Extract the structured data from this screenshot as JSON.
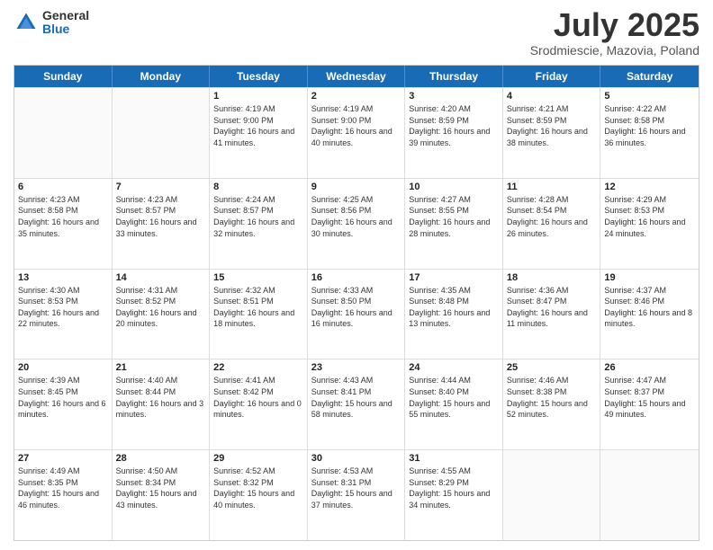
{
  "logo": {
    "general": "General",
    "blue": "Blue"
  },
  "title": "July 2025",
  "subtitle": "Srodmiescie, Mazovia, Poland",
  "days": [
    "Sunday",
    "Monday",
    "Tuesday",
    "Wednesday",
    "Thursday",
    "Friday",
    "Saturday"
  ],
  "rows": [
    [
      {
        "day": "",
        "info": ""
      },
      {
        "day": "",
        "info": ""
      },
      {
        "day": "1",
        "info": "Sunrise: 4:19 AM\nSunset: 9:00 PM\nDaylight: 16 hours\nand 41 minutes."
      },
      {
        "day": "2",
        "info": "Sunrise: 4:19 AM\nSunset: 9:00 PM\nDaylight: 16 hours\nand 40 minutes."
      },
      {
        "day": "3",
        "info": "Sunrise: 4:20 AM\nSunset: 8:59 PM\nDaylight: 16 hours\nand 39 minutes."
      },
      {
        "day": "4",
        "info": "Sunrise: 4:21 AM\nSunset: 8:59 PM\nDaylight: 16 hours\nand 38 minutes."
      },
      {
        "day": "5",
        "info": "Sunrise: 4:22 AM\nSunset: 8:58 PM\nDaylight: 16 hours\nand 36 minutes."
      }
    ],
    [
      {
        "day": "6",
        "info": "Sunrise: 4:23 AM\nSunset: 8:58 PM\nDaylight: 16 hours\nand 35 minutes."
      },
      {
        "day": "7",
        "info": "Sunrise: 4:23 AM\nSunset: 8:57 PM\nDaylight: 16 hours\nand 33 minutes."
      },
      {
        "day": "8",
        "info": "Sunrise: 4:24 AM\nSunset: 8:57 PM\nDaylight: 16 hours\nand 32 minutes."
      },
      {
        "day": "9",
        "info": "Sunrise: 4:25 AM\nSunset: 8:56 PM\nDaylight: 16 hours\nand 30 minutes."
      },
      {
        "day": "10",
        "info": "Sunrise: 4:27 AM\nSunset: 8:55 PM\nDaylight: 16 hours\nand 28 minutes."
      },
      {
        "day": "11",
        "info": "Sunrise: 4:28 AM\nSunset: 8:54 PM\nDaylight: 16 hours\nand 26 minutes."
      },
      {
        "day": "12",
        "info": "Sunrise: 4:29 AM\nSunset: 8:53 PM\nDaylight: 16 hours\nand 24 minutes."
      }
    ],
    [
      {
        "day": "13",
        "info": "Sunrise: 4:30 AM\nSunset: 8:53 PM\nDaylight: 16 hours\nand 22 minutes."
      },
      {
        "day": "14",
        "info": "Sunrise: 4:31 AM\nSunset: 8:52 PM\nDaylight: 16 hours\nand 20 minutes."
      },
      {
        "day": "15",
        "info": "Sunrise: 4:32 AM\nSunset: 8:51 PM\nDaylight: 16 hours\nand 18 minutes."
      },
      {
        "day": "16",
        "info": "Sunrise: 4:33 AM\nSunset: 8:50 PM\nDaylight: 16 hours\nand 16 minutes."
      },
      {
        "day": "17",
        "info": "Sunrise: 4:35 AM\nSunset: 8:48 PM\nDaylight: 16 hours\nand 13 minutes."
      },
      {
        "day": "18",
        "info": "Sunrise: 4:36 AM\nSunset: 8:47 PM\nDaylight: 16 hours\nand 11 minutes."
      },
      {
        "day": "19",
        "info": "Sunrise: 4:37 AM\nSunset: 8:46 PM\nDaylight: 16 hours\nand 8 minutes."
      }
    ],
    [
      {
        "day": "20",
        "info": "Sunrise: 4:39 AM\nSunset: 8:45 PM\nDaylight: 16 hours\nand 6 minutes."
      },
      {
        "day": "21",
        "info": "Sunrise: 4:40 AM\nSunset: 8:44 PM\nDaylight: 16 hours\nand 3 minutes."
      },
      {
        "day": "22",
        "info": "Sunrise: 4:41 AM\nSunset: 8:42 PM\nDaylight: 16 hours\nand 0 minutes."
      },
      {
        "day": "23",
        "info": "Sunrise: 4:43 AM\nSunset: 8:41 PM\nDaylight: 15 hours\nand 58 minutes."
      },
      {
        "day": "24",
        "info": "Sunrise: 4:44 AM\nSunset: 8:40 PM\nDaylight: 15 hours\nand 55 minutes."
      },
      {
        "day": "25",
        "info": "Sunrise: 4:46 AM\nSunset: 8:38 PM\nDaylight: 15 hours\nand 52 minutes."
      },
      {
        "day": "26",
        "info": "Sunrise: 4:47 AM\nSunset: 8:37 PM\nDaylight: 15 hours\nand 49 minutes."
      }
    ],
    [
      {
        "day": "27",
        "info": "Sunrise: 4:49 AM\nSunset: 8:35 PM\nDaylight: 15 hours\nand 46 minutes."
      },
      {
        "day": "28",
        "info": "Sunrise: 4:50 AM\nSunset: 8:34 PM\nDaylight: 15 hours\nand 43 minutes."
      },
      {
        "day": "29",
        "info": "Sunrise: 4:52 AM\nSunset: 8:32 PM\nDaylight: 15 hours\nand 40 minutes."
      },
      {
        "day": "30",
        "info": "Sunrise: 4:53 AM\nSunset: 8:31 PM\nDaylight: 15 hours\nand 37 minutes."
      },
      {
        "day": "31",
        "info": "Sunrise: 4:55 AM\nSunset: 8:29 PM\nDaylight: 15 hours\nand 34 minutes."
      },
      {
        "day": "",
        "info": ""
      },
      {
        "day": "",
        "info": ""
      }
    ]
  ]
}
